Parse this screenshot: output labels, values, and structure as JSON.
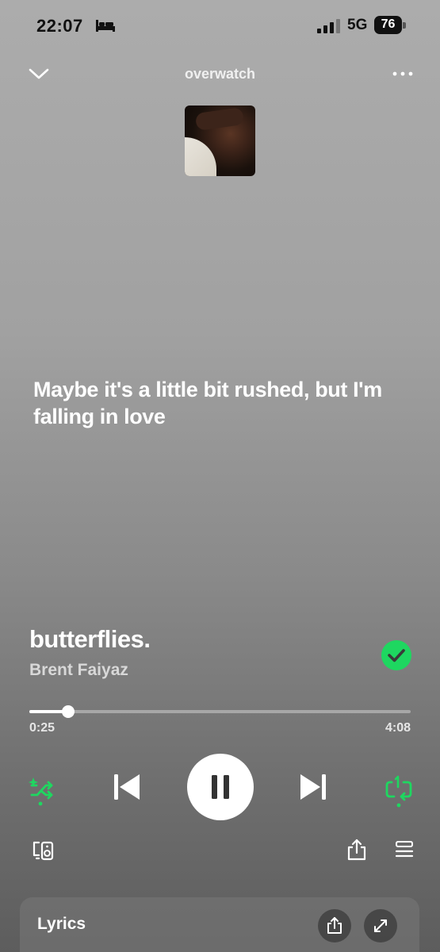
{
  "status_bar": {
    "time": "22:07",
    "network": "5G",
    "battery": "76",
    "icons": [
      "bed-icon",
      "signal-icon",
      "battery-icon"
    ]
  },
  "header": {
    "playlist_name": "overwatch",
    "icons": [
      "chevron-down-icon",
      "more-icon"
    ]
  },
  "lyric_line": "Maybe it's a little bit rushed, but I'm falling in love",
  "track": {
    "title": "butterflies.",
    "artist": "Brent Faiyaz",
    "liked": true
  },
  "progress": {
    "elapsed": "0:25",
    "total": "4:08",
    "fraction": 0.101
  },
  "controls": {
    "icons": [
      "smart-shuffle-icon",
      "previous-icon",
      "pause-icon",
      "next-icon",
      "repeat-one-icon",
      "devices-icon",
      "share-icon",
      "queue-icon"
    ],
    "active_color": "#1ed760"
  },
  "lyrics_card": {
    "label": "Lyrics",
    "icons": [
      "share-icon",
      "expand-icon"
    ]
  }
}
